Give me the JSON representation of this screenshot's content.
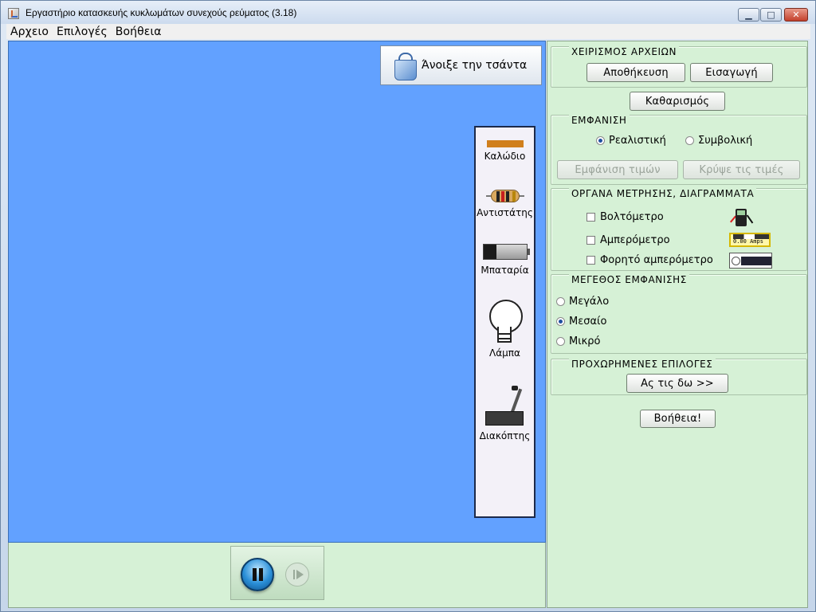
{
  "window": {
    "title": "Εργαστήριο κατασκευής κυκλωμάτων συνεχούς ρεύματος (3.18)",
    "controls": {
      "minimize": "▁",
      "maximize": "□",
      "close": "✕"
    }
  },
  "menubar": {
    "items": [
      {
        "label": "Αρχειο"
      },
      {
        "label": "Επιλογές"
      },
      {
        "label": "Βοήθεια"
      }
    ]
  },
  "canvas": {
    "background": "#62a1ff",
    "open_bag_label": "Άνοιξε την τσάντα"
  },
  "toolbox": {
    "items": [
      {
        "label": "Καλώδιο",
        "icon": "wire-icon"
      },
      {
        "label": "Αντιστάτης",
        "icon": "resistor-icon"
      },
      {
        "label": "Μπαταρία",
        "icon": "battery-icon"
      },
      {
        "label": "Λάμπα",
        "icon": "bulb-icon"
      },
      {
        "label": "Διακόπτης",
        "icon": "switch-icon"
      }
    ]
  },
  "playback": {
    "pause_icon": "pause-icon",
    "step_icon": "step-icon"
  },
  "panel": {
    "files": {
      "title": "ΧΕΙΡΙΣΜΟΣ ΑΡΧΕΙΩΝ",
      "save": "Αποθήκευση",
      "import": "Εισαγωγή"
    },
    "clear": "Καθαρισμός",
    "view": {
      "title": "ΕΜΦΑΝΙΣΗ",
      "realistic": "Ρεαλιστική",
      "symbolic": "Συμβολική",
      "selected": "realistic",
      "show_values": "Εμφάνιση τιμών",
      "hide_values": "Κρύψε τις τιμές"
    },
    "instruments": {
      "title": "ΟΡΓΑΝΑ ΜΕΤΡΗΣΗΣ, ΔΙΑΓΡΑΜΜΑΤΑ",
      "voltmeter": "Βολτόμετρο",
      "ammeter": "Αμπερόμετρο",
      "probe_ammeter": "Φορητό αμπερόμετρο",
      "ammeter_readout": "0.00 Amps"
    },
    "size": {
      "title": "ΜΕΓΕΘΟΣ ΕΜΦΑΝΙΣΗΣ",
      "large": "Μεγάλο",
      "medium": "Μεσαίο",
      "small": "Μικρό",
      "selected": "medium"
    },
    "advanced": {
      "title": "ΠΡΟΧΩΡΗΜΕΝΕΣ ΕΠΙΛΟΓΕΣ",
      "button": "Ας τις δω >>"
    },
    "help": "Βοήθεια!"
  }
}
